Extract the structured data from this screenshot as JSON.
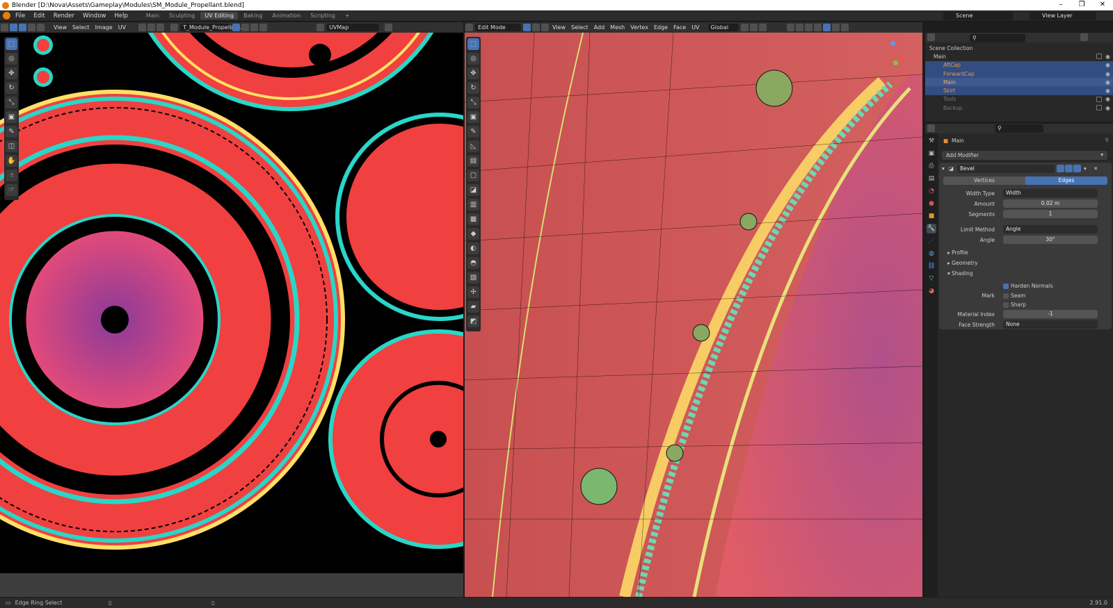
{
  "window": {
    "title": "Blender [D:\\Nova\\Assets\\Gameplay\\Modules\\SM_Module_Propellant.blend]"
  },
  "menu": [
    "File",
    "Edit",
    "Render",
    "Window",
    "Help"
  ],
  "workspaces": [
    "Main",
    "Sculpting",
    "UV Editing",
    "Baking",
    "Animation",
    "Scripting"
  ],
  "active_workspace": "UV Editing",
  "scene": {
    "scene_name": "Scene",
    "view_layer": "View Layer"
  },
  "uv_editor": {
    "menus": [
      "View",
      "Select",
      "Image",
      "UV"
    ],
    "image_name": "T_Module_Propellan...",
    "uv_map": "UVMap"
  },
  "viewport": {
    "mode": "Edit Mode",
    "menus": [
      "View",
      "Select",
      "Add",
      "Mesh",
      "Vertex",
      "Edge",
      "Face",
      "UV"
    ],
    "orientation": "Global"
  },
  "outliner": {
    "root": "Scene Collection",
    "collection": "Main",
    "items": [
      "AftCap",
      "ForwardCap",
      "Main",
      "Skirt"
    ],
    "hidden": [
      "Tools",
      "Backup"
    ]
  },
  "properties": {
    "object": "Main",
    "add_modifier": "Add Modifier",
    "modifier_name": "Bevel",
    "affect_tabs": [
      "Vertices",
      "Edges"
    ],
    "active_affect": "Edges",
    "width_type": {
      "label": "Width Type",
      "value": "Width"
    },
    "amount": {
      "label": "Amount",
      "value": "0.02 m"
    },
    "segments": {
      "label": "Segments",
      "value": "1"
    },
    "limit_method": {
      "label": "Limit Method",
      "value": "Angle"
    },
    "angle": {
      "label": "Angle",
      "value": "30°"
    },
    "panels": [
      "Profile",
      "Geometry",
      "Shading"
    ],
    "harden_normals": "Harden Normals",
    "mark_label": "Mark",
    "seam": "Seam",
    "sharp": "Sharp",
    "material_index": {
      "label": "Material Index",
      "value": "-1"
    },
    "face_strength": {
      "label": "Face Strength",
      "value": "None"
    }
  },
  "status": {
    "left": "Edge Ring Select",
    "version": "2.91.0"
  },
  "colors": {
    "accent": "#4772b3",
    "uv_red": "#f0413c",
    "uv_cyan": "#2ad6c8",
    "uv_pink": "#d84a8a",
    "mesh_red": "#d45a5a"
  }
}
